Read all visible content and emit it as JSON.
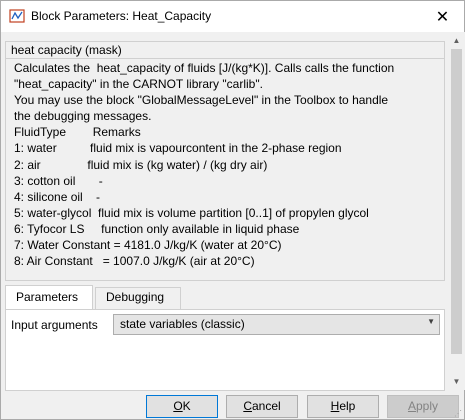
{
  "window": {
    "title": "Block Parameters: Heat_Capacity",
    "close_glyph": "✕"
  },
  "mask": {
    "header": "heat capacity (mask)",
    "description_lines": [
      "Calculates the  heat_capacity of fluids [J/(kg*K)]. Calls calls the function",
      "\"heat_capacity\" in the CARNOT library \"carlib\".",
      "You may use the block \"GlobalMessageLevel\" in the Toolbox to handle",
      "the debugging messages.",
      "FluidType        Remarks",
      "1: water          fluid mix is vapourcontent in the 2-phase region",
      "2: air              fluid mix is (kg water) / (kg dry air)",
      "3: cotton oil       -",
      "4: silicone oil    -",
      "5: water-glycol  fluid mix is volume partition [0..1] of propylen glycol",
      "6: Tyfocor LS     function only available in liquid phase",
      "7: Water Constant = 4181.0 J/kg/K (water at 20°C)",
      "8: Air Constant   = 1007.0 J/kg/K (air at 20°C)"
    ]
  },
  "tabs": [
    {
      "label": "Parameters",
      "active": true
    },
    {
      "label": "Debugging",
      "active": false
    }
  ],
  "parameters": {
    "input_arguments_label": "Input arguments",
    "input_arguments_value": "state variables (classic)"
  },
  "buttons": {
    "ok": {
      "prefix": "",
      "underline": "O",
      "suffix": "K"
    },
    "cancel": {
      "prefix": "",
      "underline": "C",
      "suffix": "ancel"
    },
    "help": {
      "prefix": "",
      "underline": "H",
      "suffix": "elp"
    },
    "apply": {
      "prefix": "",
      "underline": "A",
      "suffix": "pply"
    }
  },
  "icons": {
    "app": "simulink-block-icon",
    "close": "close-icon",
    "dropdown": "chevron-down-icon",
    "scroll_up": "scroll-up-icon",
    "scroll_down": "scroll-down-icon"
  },
  "colors": {
    "accent": "#0078d7",
    "window_bg": "#f0f0f0",
    "disabled_text": "#838383"
  }
}
